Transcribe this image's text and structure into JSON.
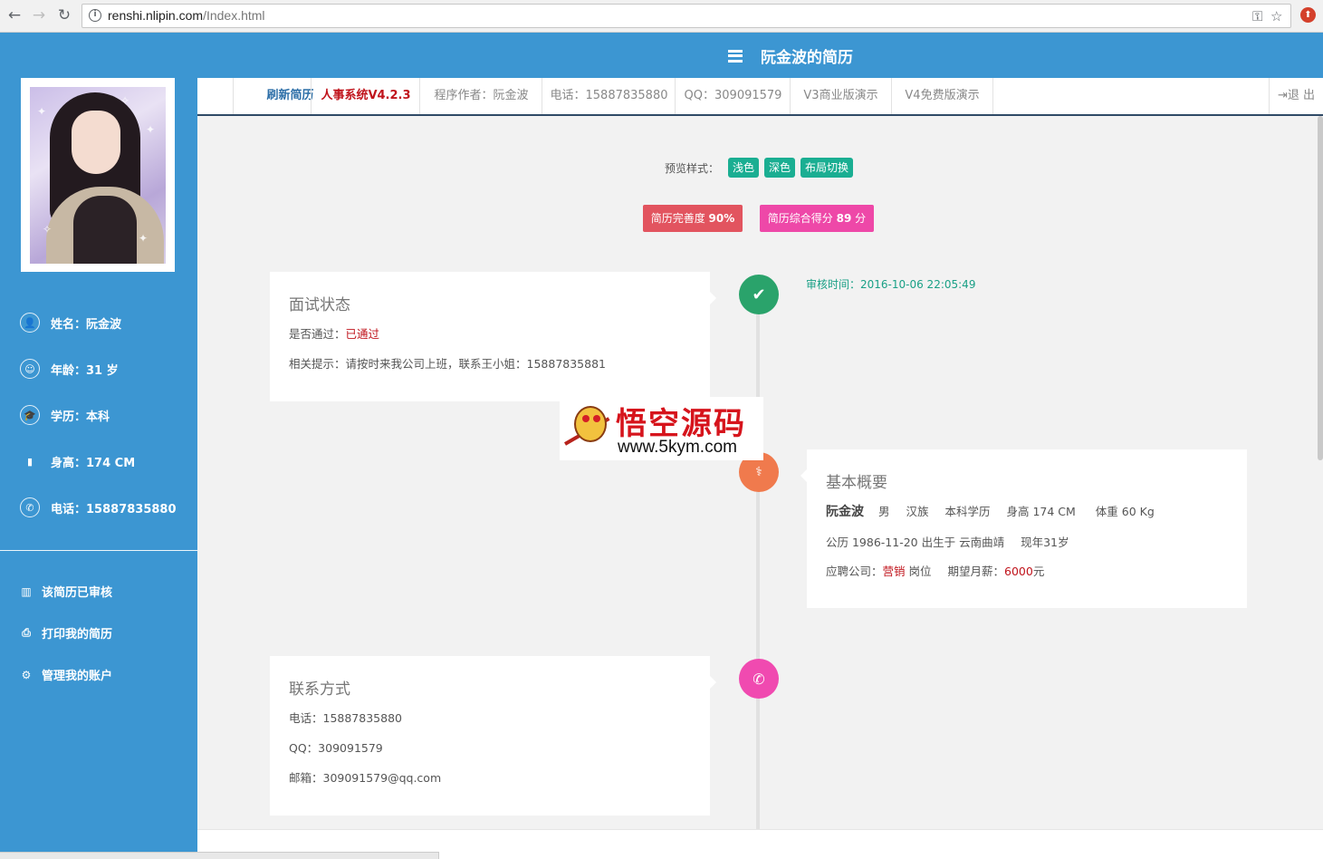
{
  "browser": {
    "url_host": "renshi.nlipin.com",
    "url_path": "/Index.html"
  },
  "header": {
    "title": "阮金波的简历"
  },
  "tabs": [
    {
      "label": "刷新简历"
    },
    {
      "label": "人事系统V4.2.3"
    },
    {
      "label": "程序作者：阮金波"
    },
    {
      "label": "电话：15887835880"
    },
    {
      "label": "QQ：309091579"
    },
    {
      "label": "V3商业版演示"
    },
    {
      "label": "V4免费版演示"
    }
  ],
  "logout_label": "退 出",
  "sidebar": {
    "name": "姓名：阮金波",
    "age": "年龄：31 岁",
    "education": "学历：本科",
    "height": "身高：174 CM",
    "phone": "电话：15887835880",
    "links": [
      "该简历已审核",
      "打印我的简历",
      "管理我的账户"
    ]
  },
  "preview": {
    "label": "预览样式：",
    "buttons": [
      "浅色",
      "深色",
      "布局切换"
    ]
  },
  "scores": {
    "completeness_label": "简历完善度",
    "completeness_value": "90%",
    "overall_label": "简历综合得分",
    "overall_value": "89",
    "overall_unit": "分",
    "completeness_color": "#e2545f",
    "overall_color": "#ee48a8"
  },
  "interview": {
    "title": "面试状态",
    "pass_label": "是否通过：",
    "pass_value": "已通过",
    "tip": "相关提示：请按时来我公司上班，联系王小姐：15887835881",
    "audit_time": "审核时间：2016-10-06 22:05:49"
  },
  "overview": {
    "title": "基本概要",
    "name": "阮金波",
    "gender": "男",
    "ethnicity": "汉族",
    "education": "本科学历",
    "height": "身高 174 CM",
    "weight": "体重 60 Kg",
    "birth": "公历 1986-11-20 出生于 云南曲靖",
    "age_now": "现年31岁",
    "apply_label": "应聘公司：",
    "apply_value": "营销",
    "position_label": "岗位",
    "salary_label": "期望月薪：",
    "salary_value": "6000",
    "salary_unit": "元"
  },
  "contact": {
    "title": "联系方式",
    "phone": "电话：15887835880",
    "qq": "QQ：309091579",
    "email": "邮箱：309091579@qq.com"
  },
  "watermark": {
    "text_cn": "悟空源码",
    "text_url": "www.5kym.com"
  },
  "colors": {
    "primary": "#3c96d2",
    "green_dot": "#2aa36b",
    "orange_dot": "#f07a4d",
    "pink_dot": "#f04ab0",
    "teal": "#1aae92"
  },
  "icons": {
    "check": "✔",
    "user_md": "⚕",
    "phone": "✆"
  }
}
